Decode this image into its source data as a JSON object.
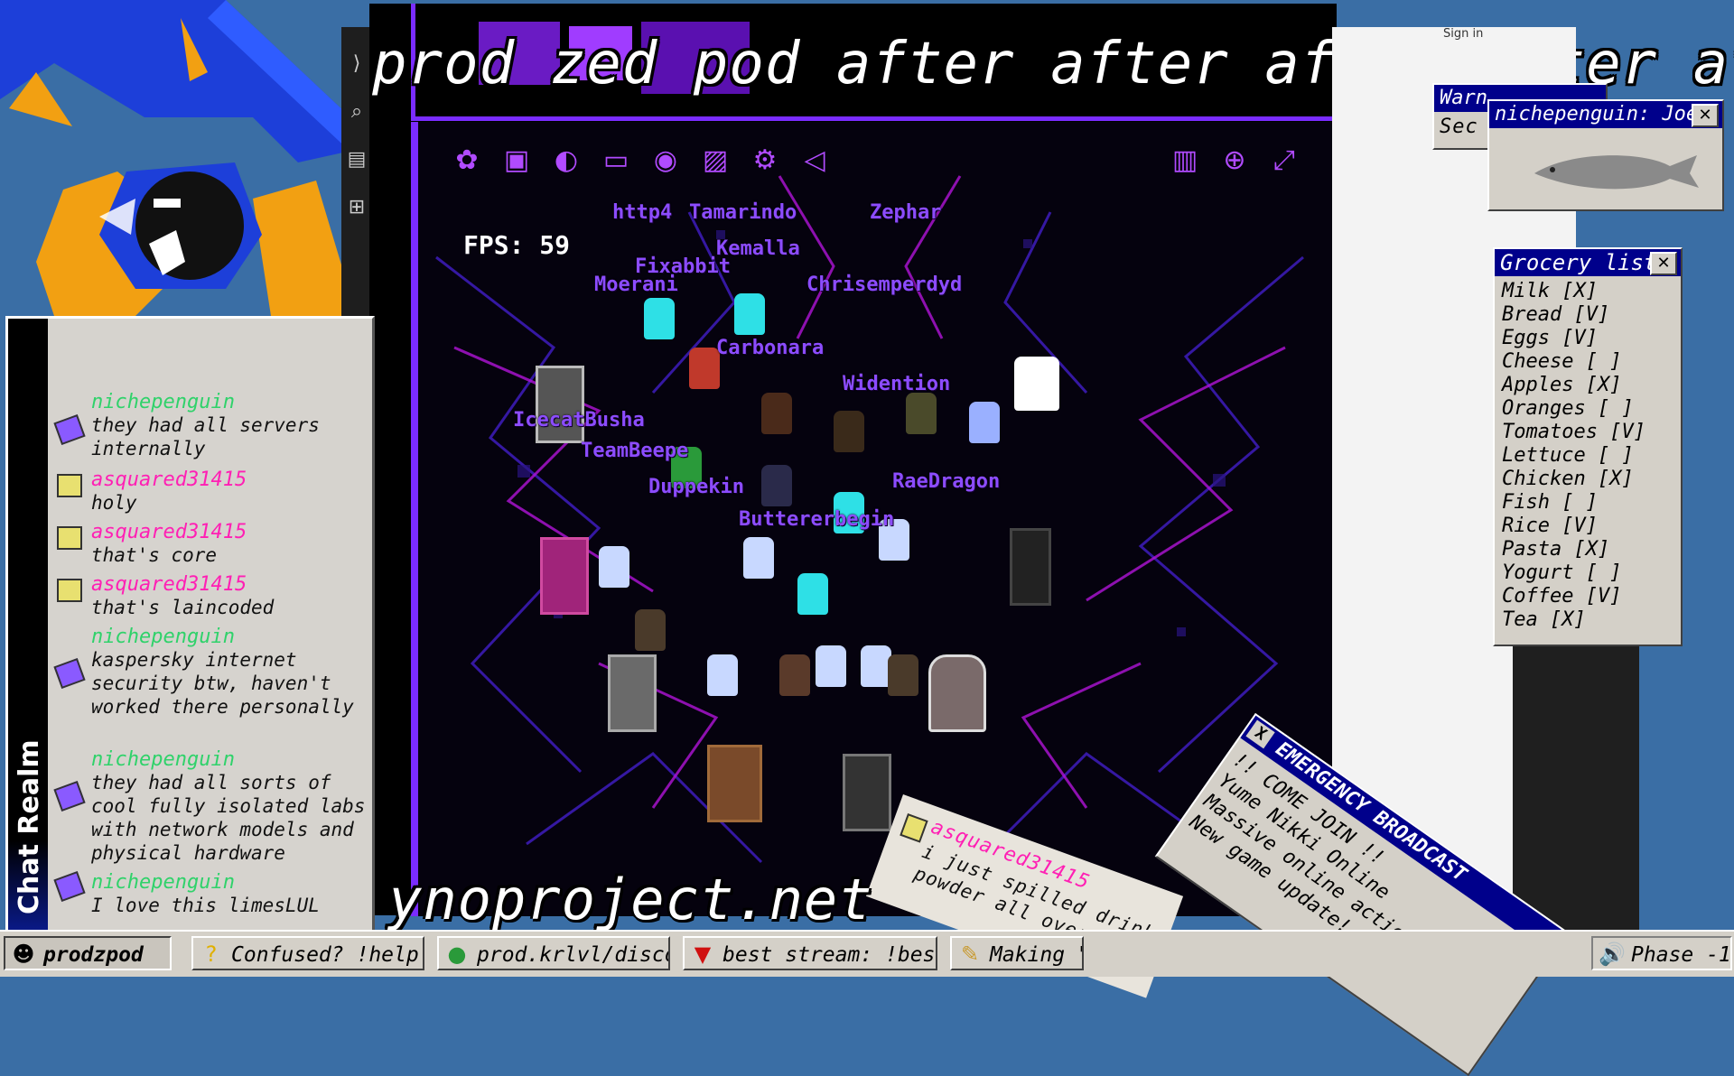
{
  "banner_text": "prod zed pod after after after after after a",
  "domain_text": "ynoproject.net",
  "game": {
    "fps_label": "FPS: 59",
    "player_names": [
      "http4",
      "Tamarindo",
      "Zephar",
      "Kemalla",
      "Fixabbit",
      "Moerani",
      "Chrisemperdyd",
      "Carbonara",
      "Widention",
      "IcecatBusha",
      "TeamBeepe",
      "Duppekin",
      "Buttererbegin",
      "RaeDragon"
    ]
  },
  "chat": {
    "sidebar_label": "Chat Realm",
    "messages": [
      {
        "user": "nichepenguin",
        "text": "they had all servers internally",
        "color": "#2fd26a"
      },
      {
        "user": "asquared31415",
        "text": "holy",
        "color": "#ff1fb4"
      },
      {
        "user": "asquared31415",
        "text": "that's core",
        "color": "#ff1fb4"
      },
      {
        "user": "asquared31415",
        "text": "that's laincoded",
        "color": "#ff1fb4"
      },
      {
        "user": "nichepenguin",
        "text": "kaspersky internet security btw, haven't worked there personally",
        "color": "#2fd26a"
      },
      {
        "user": "nichepenguin",
        "text": "they had all sorts of cool fully isolated labs with network models and physical hardware",
        "color": "#2fd26a"
      },
      {
        "user": "nichepenguin",
        "text": "I love this limesLUL",
        "color": "#2fd26a"
      }
    ]
  },
  "browser": {
    "signin": "Sign in"
  },
  "warning_window": {
    "title": "Warn",
    "body": "Sec"
  },
  "joel_window": {
    "title": "nichepenguin: Joel"
  },
  "grocery": {
    "title": "Grocery list",
    "items": [
      "Milk [X]",
      "Bread [V]",
      "Eggs [V]",
      "Cheese [ ]",
      "Apples [X]",
      "Oranges [ ]",
      "Tomatoes [V]",
      "Lettuce [ ]",
      "Chicken [X]",
      "Fish [ ]",
      "Rice [V]",
      "Pasta [X]",
      "Yogurt [ ]",
      "Coffee [V]",
      "Tea [X]"
    ]
  },
  "emergency": {
    "title": "EMERGENCY BROADCAST",
    "lines": [
      "!! COME JOIN !!",
      "Yume Nikki Online",
      "Massive online action!",
      "New game update!"
    ],
    "close": "X"
  },
  "spilled": {
    "user": "asquared31415",
    "text": "i just spilled drink powder all over"
  },
  "taskbar": {
    "start_label": "prodzpod",
    "tasks": [
      {
        "label": "Confused? !help",
        "icon": "?"
      },
      {
        "label": "prod.krlvl/discord",
        "icon": "●"
      },
      {
        "label": "best stream: !best",
        "icon": "▼"
      },
      {
        "label": "Making \"\"",
        "icon": "✎"
      }
    ],
    "tray_label": "Phase -1",
    "tray_icon": "🔊"
  },
  "colors": {
    "accent": "#7a2cff",
    "name_purple": "#8c4cff",
    "title_blue": "#00008b"
  }
}
